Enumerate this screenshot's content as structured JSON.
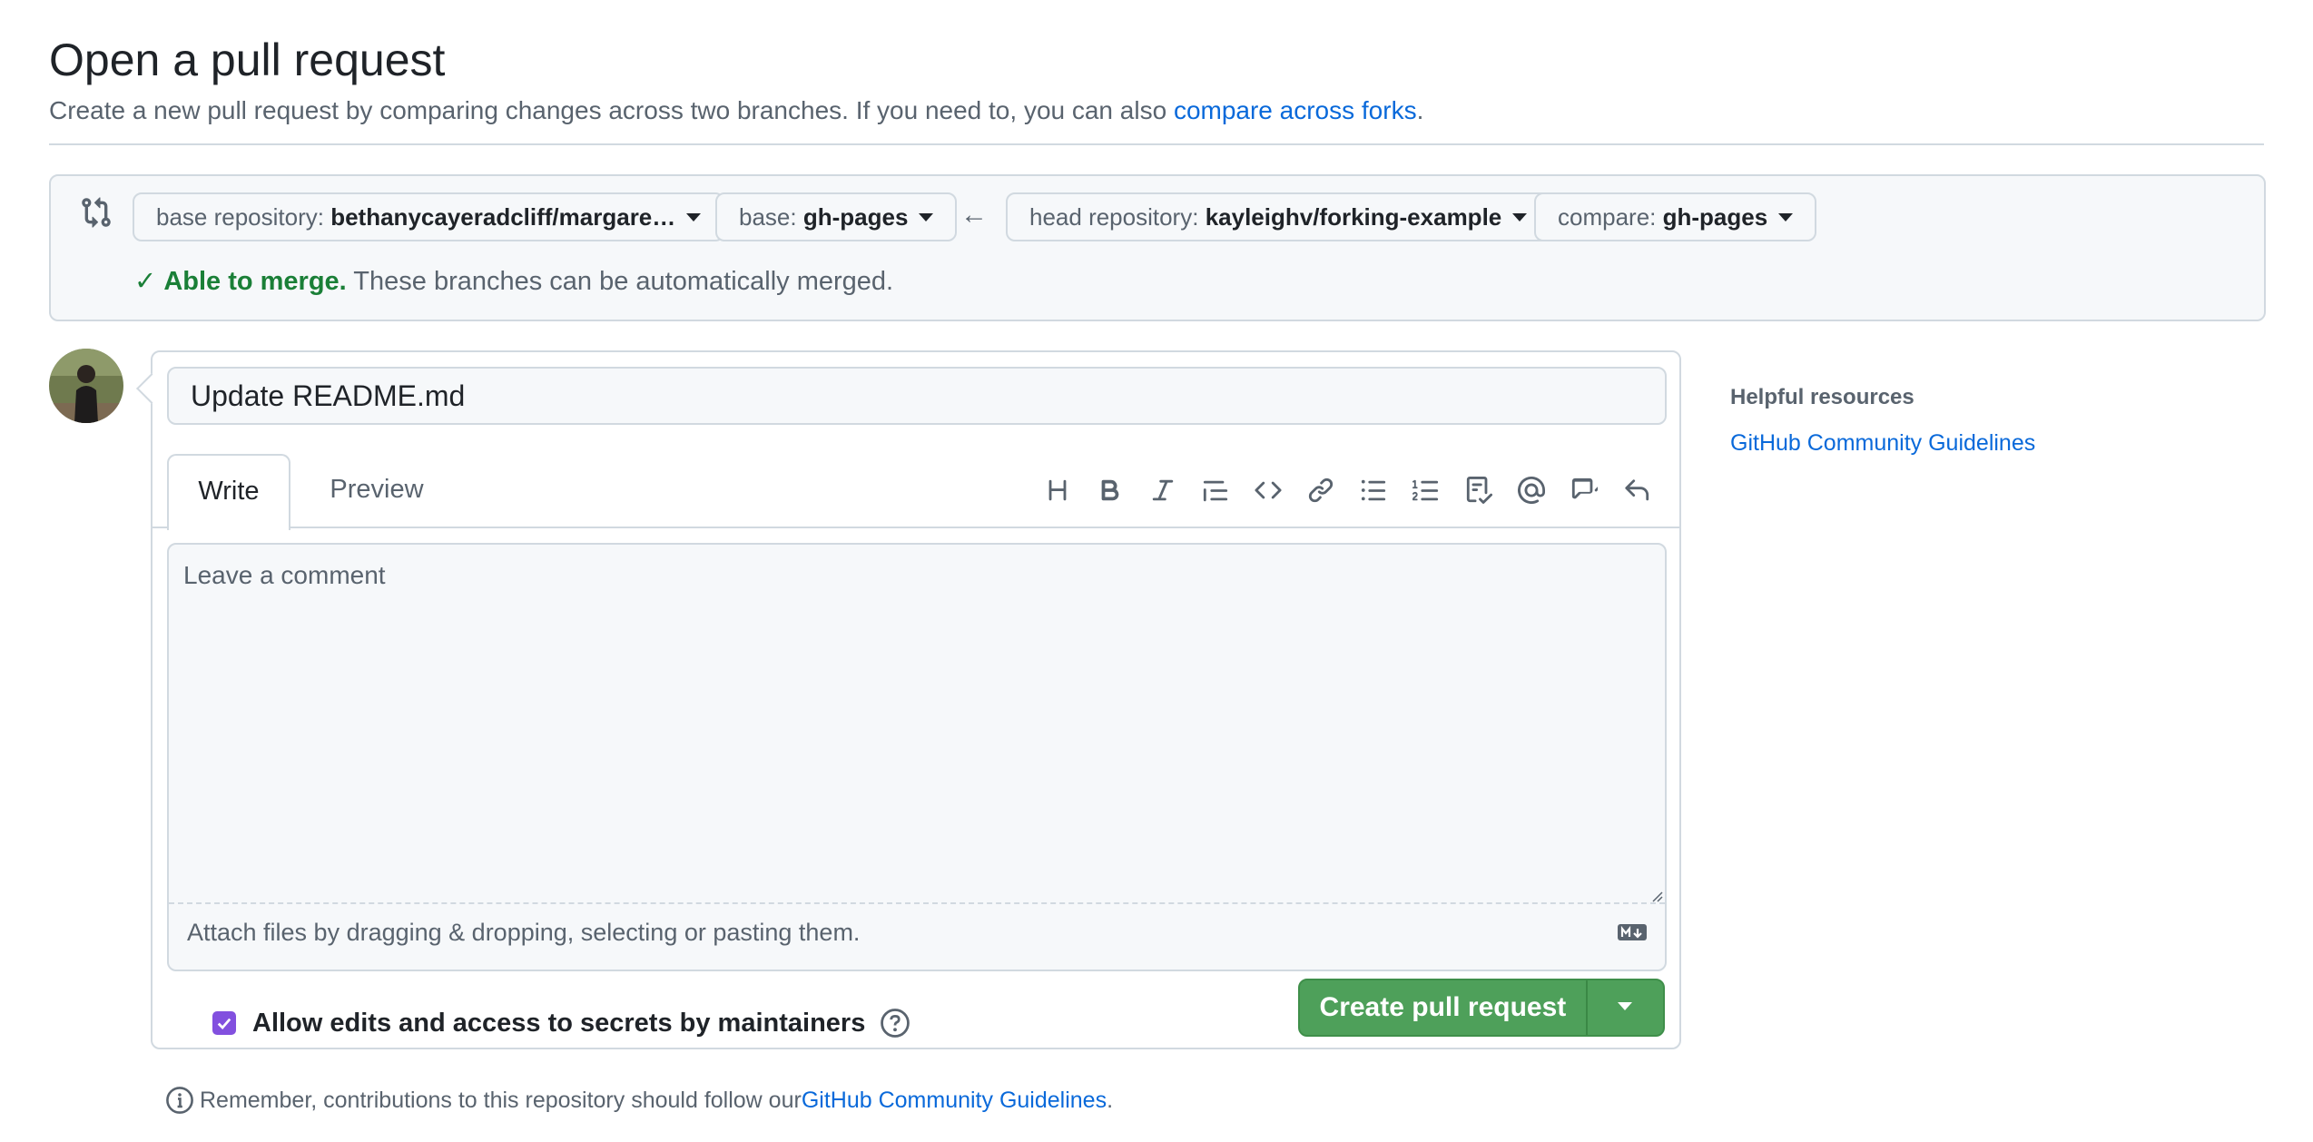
{
  "header": {
    "title": "Open a pull request",
    "subtitle_text": "Create a new pull request by comparing changes across two branches. If you need to, you can also ",
    "subtitle_link": "compare across forks",
    "subtitle_end": "."
  },
  "compare": {
    "base_repo_label": "base repository:",
    "base_repo_value": "bethanycayeradcliff/margare…",
    "base_label": "base:",
    "base_value": "gh-pages",
    "head_repo_label": "head repository:",
    "head_repo_value": "kayleighv/forking-example",
    "compare_label": "compare:",
    "compare_value": "gh-pages",
    "merge_status": "Able to merge.",
    "merge_text": " These branches can be automatically merged."
  },
  "form": {
    "title_value": "Update README.md",
    "tabs": [
      "Write",
      "Preview"
    ],
    "comment_placeholder": "Leave a comment",
    "attach_text": "Attach files by dragging & dropping, selecting or pasting them.",
    "allow_edits_label": "Allow edits and access to secrets by maintainers",
    "allow_edits_checked": true,
    "create_button": "Create pull request"
  },
  "toolbar_icons": [
    "heading-icon",
    "bold-icon",
    "italic-icon",
    "quote-icon",
    "code-icon",
    "link-icon",
    "unordered-list-icon",
    "ordered-list-icon",
    "task-list-icon",
    "mention-icon",
    "cross-reference-icon",
    "reply-icon"
  ],
  "footer": {
    "remember_text": "Remember, contributions to this repository should follow our ",
    "remember_link": "GitHub Community Guidelines",
    "remember_end": "."
  },
  "sidebar": {
    "heading": "Helpful resources",
    "link": "GitHub Community Guidelines"
  },
  "colors": {
    "link": "#0969da",
    "success": "#1a7f37",
    "primary_button": "#4ea05a",
    "checkbox": "#8250df"
  }
}
